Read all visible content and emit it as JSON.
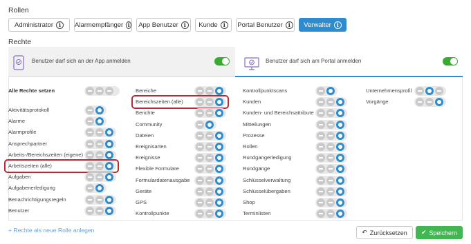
{
  "roles": {
    "heading": "Rollen",
    "buttons": [
      "Administrator",
      "Alarmempfänger",
      "App Benutzer",
      "Kunde",
      "Portal Benutzer",
      "Verwalter"
    ],
    "info_glyph": "i",
    "active": "Verwalter"
  },
  "rights": {
    "heading": "Rechte",
    "app_panel": {
      "text": "Benutzer darf sich an der App anmelden",
      "toggle_on": true,
      "icon": "phone-check-icon"
    },
    "portal_panel": {
      "text": "Benutzer darf sich am Portal anmelden",
      "toggle_on": true,
      "icon": "desktop-check-icon"
    }
  },
  "all_rights_label": "Alle Rechte setzen",
  "columns": [
    {
      "items": [
        {
          "label": "Aktivitätsprotokoll",
          "state": [
            0,
            1
          ]
        },
        {
          "label": "Alarme",
          "state": [
            0,
            1
          ]
        },
        {
          "label": "Alarmprofile",
          "state": [
            0,
            0,
            1
          ]
        },
        {
          "label": "Ansprechpartner",
          "state": [
            0,
            0,
            1
          ]
        },
        {
          "label": "Arbeits-/Bereichszeiten (eigene)",
          "state": [
            0,
            0,
            1
          ]
        },
        {
          "label": "Arbeitszeiten (alle)",
          "state": [
            0,
            0,
            1
          ],
          "highlight": true
        },
        {
          "label": "Aufgaben",
          "state": [
            0,
            0,
            1
          ]
        },
        {
          "label": "Aufgabenerledigung",
          "state": [
            0,
            1
          ]
        },
        {
          "label": "Benachrichtigungsregeln",
          "state": [
            0,
            0,
            1
          ]
        },
        {
          "label": "Benutzer",
          "state": [
            0,
            0,
            1
          ]
        }
      ]
    },
    {
      "items": [
        {
          "label": "Bereiche",
          "state": [
            0,
            0,
            1
          ]
        },
        {
          "label": "Bereichszeiten (alle)",
          "state": [
            0,
            0,
            1
          ],
          "highlight": true
        },
        {
          "label": "Berichte",
          "state": [
            0,
            0,
            1
          ]
        },
        {
          "label": "Community",
          "state": [
            0,
            1
          ]
        },
        {
          "label": "Dateien",
          "state": [
            0,
            0,
            1
          ]
        },
        {
          "label": "Ereignisarten",
          "state": [
            0,
            0,
            1
          ]
        },
        {
          "label": "Ereignisse",
          "state": [
            0,
            0,
            1
          ]
        },
        {
          "label": "Flexible Formulare",
          "state": [
            0,
            0,
            1
          ]
        },
        {
          "label": "Formulardatenausgabe",
          "state": [
            0,
            0,
            1
          ]
        },
        {
          "label": "Geräte",
          "state": [
            0,
            0,
            1
          ]
        },
        {
          "label": "GPS",
          "state": [
            0,
            0,
            1
          ]
        },
        {
          "label": "Kontrollpunkte",
          "state": [
            0,
            0,
            1
          ]
        }
      ]
    },
    {
      "items": [
        {
          "label": "Kontrollpunktscans",
          "state": [
            0,
            1
          ]
        },
        {
          "label": "Kunden",
          "state": [
            0,
            0,
            1
          ]
        },
        {
          "label": "Kunden- und Bereichsattribute",
          "state": [
            0,
            0,
            1
          ]
        },
        {
          "label": "Mitteilungen",
          "state": [
            0,
            0,
            1
          ]
        },
        {
          "label": "Prozesse",
          "state": [
            0,
            0,
            1
          ]
        },
        {
          "label": "Rollen",
          "state": [
            0,
            0,
            1
          ]
        },
        {
          "label": "Rundgangerledigung",
          "state": [
            0,
            0,
            1
          ]
        },
        {
          "label": "Rundgänge",
          "state": [
            0,
            0,
            1
          ]
        },
        {
          "label": "Schlüsselverwaltung",
          "state": [
            0,
            0,
            1
          ]
        },
        {
          "label": "Schlüsselübergaben",
          "state": [
            0,
            0,
            1
          ]
        },
        {
          "label": "Shop",
          "state": [
            0,
            0,
            1
          ]
        },
        {
          "label": "Terminlisten",
          "state": [
            0,
            0,
            1
          ]
        }
      ]
    },
    {
      "items": [
        {
          "label": "Unternehmensprofil",
          "state": [
            0,
            1,
            0
          ]
        },
        {
          "label": "Vorgänge",
          "state": [
            0,
            0,
            1
          ]
        }
      ]
    }
  ],
  "footer": {
    "add_role_link": "+ Rechte als neue Rolle anlegen",
    "reset_label": "Zurücksetzen",
    "save_label": "Speichern"
  },
  "colors": {
    "accent": "#2e8bcd",
    "success": "#42b751",
    "highlight": "#b32b35"
  }
}
